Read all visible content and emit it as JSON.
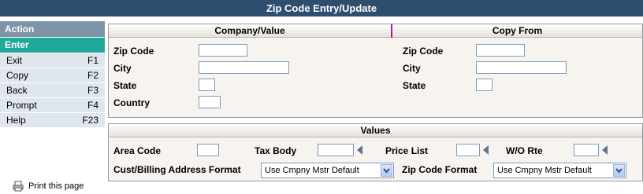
{
  "title": "Zip Code Entry/Update",
  "sidebar": {
    "header": "Action",
    "enter": "Enter",
    "items": [
      {
        "label": "Exit",
        "key": "F1"
      },
      {
        "label": "Copy",
        "key": "F2"
      },
      {
        "label": "Back",
        "key": "F3"
      },
      {
        "label": "Prompt",
        "key": "F4"
      },
      {
        "label": "Help",
        "key": "F23"
      }
    ]
  },
  "print_link": "Print this page",
  "company": {
    "header": "Company/Value",
    "zip_label": "Zip Code",
    "city_label": "City",
    "state_label": "State",
    "country_label": "Country",
    "zip_value": "",
    "city_value": "",
    "state_value": "",
    "country_value": ""
  },
  "copy_from": {
    "header": "Copy From",
    "zip_label": "Zip Code",
    "city_label": "City",
    "state_label": "State",
    "zip_value": "",
    "city_value": "",
    "state_value": ""
  },
  "values": {
    "header": "Values",
    "area_code_label": "Area Code",
    "tax_body_label": "Tax Body",
    "price_list_label": "Price List",
    "wo_rte_label": "W/O Rte",
    "cust_billing_label": "Cust/Billing Address Format",
    "cust_billing_value": "Use Cmpny Mstr Default",
    "zip_format_label": "Zip Code Format",
    "zip_format_value": "Use Cmpny Mstr Default"
  },
  "colors": {
    "titlebar": "#2d4e6e",
    "enter": "#1fa99a",
    "sidebar_header": "#7c93a8"
  }
}
